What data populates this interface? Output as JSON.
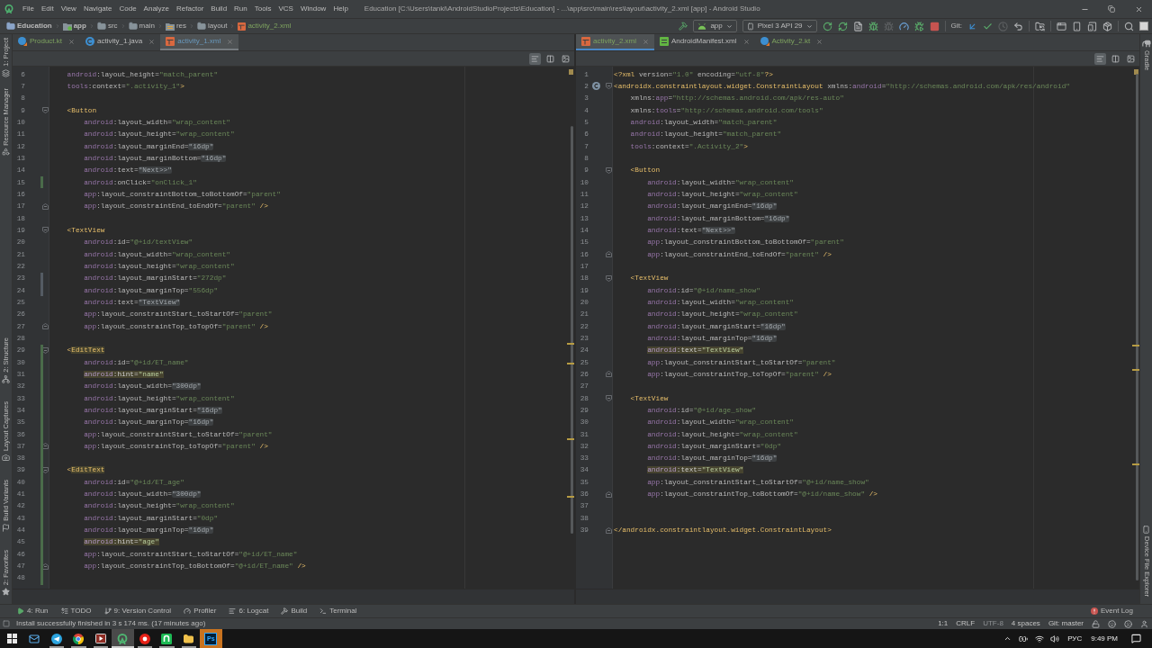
{
  "window": {
    "title": "Education [C:\\Users\\tanki\\AndroidStudioProjects\\Education] - ...\\app\\src\\main\\res\\layout\\activity_2.xml [app] - Android Studio"
  },
  "menu": [
    "File",
    "Edit",
    "View",
    "Navigate",
    "Code",
    "Analyze",
    "Refactor",
    "Build",
    "Run",
    "Tools",
    "VCS",
    "Window",
    "Help"
  ],
  "breadcrumbs": [
    {
      "label": "Education",
      "kind": "project"
    },
    {
      "label": "app",
      "kind": "module"
    },
    {
      "label": "src",
      "kind": "folder"
    },
    {
      "label": "main",
      "kind": "folder"
    },
    {
      "label": "res",
      "kind": "resources"
    },
    {
      "label": "layout",
      "kind": "folder"
    },
    {
      "label": "activity_2.xml",
      "kind": "layout-file"
    }
  ],
  "toolbar": {
    "run_config": "app",
    "device": "Pixel 3 API 29",
    "run_actions": [
      {
        "kind": "apply-changes",
        "disabled": false
      },
      {
        "kind": "apply-code",
        "disabled": false
      },
      {
        "kind": "run-document",
        "disabled": false
      },
      {
        "kind": "debug",
        "disabled": false
      },
      {
        "kind": "attach",
        "disabled": true
      },
      {
        "kind": "profile",
        "disabled": false
      },
      {
        "kind": "attach-debugger",
        "disabled": false
      },
      {
        "kind": "stop",
        "disabled": false
      }
    ],
    "vcs_label": "Git:",
    "vcs_actions": [
      {
        "kind": "update",
        "disabled": false
      },
      {
        "kind": "commit",
        "disabled": false
      },
      {
        "kind": "history",
        "disabled": true
      },
      {
        "kind": "rollback",
        "disabled": false
      }
    ]
  },
  "left_strip": {
    "top": [
      {
        "label": "1: Project",
        "kind": "project"
      },
      {
        "label": "Resource Manager",
        "kind": "resources"
      }
    ],
    "bottom": [
      {
        "label": "2: Structure",
        "kind": "structure"
      },
      {
        "label": "Layout Captures",
        "kind": "captures"
      },
      {
        "label": "Build Variants",
        "kind": "variants"
      },
      {
        "label": "2: Favorites",
        "kind": "favorites"
      }
    ]
  },
  "right_strip": {
    "top": [
      {
        "label": "Gradle",
        "kind": "gradle"
      }
    ],
    "bottom": [
      {
        "label": "Device File Explorer",
        "kind": "device"
      }
    ]
  },
  "editors": [
    {
      "focused": false,
      "tabs": [
        {
          "label": "Product.kt",
          "kind": "kotlin",
          "vcs": {
            "kind": "added"
          },
          "selected": false
        },
        {
          "label": "activity_1.java",
          "kind": "java",
          "vcs": {
            "kind": "unchanged"
          },
          "selected": false
        },
        {
          "label": "activity_1.xml",
          "kind": "layout",
          "vcs": {
            "kind": "modified"
          },
          "selected": true
        }
      ],
      "view_modes": [
        {
          "kind": "code",
          "selected": true
        },
        {
          "kind": "split",
          "selected": false
        },
        {
          "kind": "design",
          "selected": false
        }
      ],
      "lines": [
        {
          "n": "6",
          "kind": "plain",
          "code": "    android:layout_height=\"match_parent\""
        },
        {
          "n": "7",
          "kind": "plain",
          "code": "    tools:context=\".activity_1\">"
        },
        {
          "n": "8"
        },
        {
          "n": "9",
          "kind": "plain",
          "fold": {
            "kind": "start"
          },
          "code": "    <Button"
        },
        {
          "n": "10",
          "kind": "plain",
          "code": "        android:layout_width=\"wrap_content\""
        },
        {
          "n": "11",
          "kind": "plain",
          "code": "        android:layout_height=\"wrap_content\""
        },
        {
          "n": "12",
          "kind": "folded",
          "code": "        android:layout_marginEnd=\"16dp\""
        },
        {
          "n": "13",
          "kind": "folded",
          "code": "        android:layout_marginBottom=\"16dp\""
        },
        {
          "n": "14",
          "kind": "folded",
          "code": "        android:text=\"Next>>\""
        },
        {
          "n": "15",
          "kind": "plain",
          "change": {
            "kind": "added"
          },
          "code": "        android:onClick=\"onClick_1\""
        },
        {
          "n": "16",
          "kind": "plain",
          "code": "        app:layout_constraintBottom_toBottomOf=\"parent\""
        },
        {
          "n": "17",
          "kind": "plain",
          "fold": {
            "kind": "end"
          },
          "code": "        app:layout_constraintEnd_toEndOf=\"parent\" />"
        },
        {
          "n": "18"
        },
        {
          "n": "19",
          "kind": "plain",
          "fold": {
            "kind": "start"
          },
          "code": "    <TextView"
        },
        {
          "n": "20",
          "kind": "plain",
          "code": "        android:id=\"@+id/textView\""
        },
        {
          "n": "21",
          "kind": "plain",
          "code": "        android:layout_width=\"wrap_content\""
        },
        {
          "n": "22",
          "kind": "plain",
          "code": "        android:layout_height=\"wrap_content\""
        },
        {
          "n": "23",
          "kind": "plain",
          "change": {
            "kind": "modified"
          },
          "code": "        android:layout_marginStart=\"272dp\""
        },
        {
          "n": "24",
          "kind": "plain",
          "change": {
            "kind": "modified"
          },
          "code": "        android:layout_marginTop=\"556dp\""
        },
        {
          "n": "25",
          "kind": "folded",
          "code": "        android:text=\"TextView\""
        },
        {
          "n": "26",
          "kind": "plain",
          "code": "        app:layout_constraintStart_toStartOf=\"parent\""
        },
        {
          "n": "27",
          "kind": "plain",
          "fold": {
            "kind": "end"
          },
          "code": "        app:layout_constraintTop_toTopOf=\"parent\" />"
        },
        {
          "n": "28"
        },
        {
          "n": "29",
          "kind": "warntag",
          "fold": {
            "kind": "start"
          },
          "change": {
            "kind": "added"
          },
          "code": "    <EditText"
        },
        {
          "n": "30",
          "kind": "plain",
          "change": {
            "kind": "added"
          },
          "code": "        android:id=\"@+id/ET_name\""
        },
        {
          "n": "31",
          "kind": "warning",
          "change": {
            "kind": "added"
          },
          "code": "        android:hint=\"name\""
        },
        {
          "n": "32",
          "kind": "folded",
          "change": {
            "kind": "added"
          },
          "code": "        android:layout_width=\"300dp\""
        },
        {
          "n": "33",
          "kind": "plain",
          "change": {
            "kind": "added"
          },
          "code": "        android:layout_height=\"wrap_content\""
        },
        {
          "n": "34",
          "kind": "folded",
          "change": {
            "kind": "added"
          },
          "code": "        android:layout_marginStart=\"16dp\""
        },
        {
          "n": "35",
          "kind": "folded",
          "change": {
            "kind": "added"
          },
          "code": "        android:layout_marginTop=\"16dp\""
        },
        {
          "n": "36",
          "kind": "plain",
          "change": {
            "kind": "added"
          },
          "code": "        app:layout_constraintStart_toStartOf=\"parent\""
        },
        {
          "n": "37",
          "kind": "plain",
          "fold": {
            "kind": "end"
          },
          "change": {
            "kind": "added"
          },
          "code": "        app:layout_constraintTop_toTopOf=\"parent\" />"
        },
        {
          "n": "38",
          "change": {
            "kind": "added"
          }
        },
        {
          "n": "39",
          "kind": "warntag",
          "fold": {
            "kind": "start"
          },
          "change": {
            "kind": "added"
          },
          "code": "    <EditText"
        },
        {
          "n": "40",
          "kind": "plain",
          "change": {
            "kind": "added"
          },
          "code": "        android:id=\"@+id/ET_age\""
        },
        {
          "n": "41",
          "kind": "folded",
          "change": {
            "kind": "added"
          },
          "code": "        android:layout_width=\"300dp\""
        },
        {
          "n": "42",
          "kind": "plain",
          "change": {
            "kind": "added"
          },
          "code": "        android:layout_height=\"wrap_content\""
        },
        {
          "n": "43",
          "kind": "plain",
          "change": {
            "kind": "added"
          },
          "code": "        android:layout_marginStart=\"0dp\""
        },
        {
          "n": "44",
          "kind": "folded",
          "change": {
            "kind": "added"
          },
          "code": "        android:layout_marginTop=\"16dp\""
        },
        {
          "n": "45",
          "kind": "warning",
          "change": {
            "kind": "added"
          },
          "code": "        android:hint=\"age\""
        },
        {
          "n": "46",
          "kind": "plain",
          "change": {
            "kind": "added"
          },
          "code": "        app:layout_constraintStart_toStartOf=\"@+id/ET_name\""
        },
        {
          "n": "47",
          "kind": "plain",
          "fold": {
            "kind": "end"
          },
          "change": {
            "kind": "added"
          },
          "code": "        app:layout_constraintTop_toBottomOf=\"@+id/ET_name\" />"
        },
        {
          "n": "48",
          "change": {
            "kind": "added"
          }
        }
      ]
    },
    {
      "focused": true,
      "tabs": [
        {
          "label": "activity_2.xml",
          "kind": "layout",
          "vcs": {
            "kind": "added"
          },
          "selected": true
        },
        {
          "label": "AndroidManifest.xml",
          "kind": "manifest",
          "vcs": {
            "kind": "unchanged"
          },
          "selected": false
        },
        {
          "label": "Activity_2.kt",
          "kind": "kotlin",
          "vcs": {
            "kind": "added"
          },
          "selected": false
        }
      ],
      "view_modes": [
        {
          "kind": "code",
          "selected": true
        },
        {
          "kind": "split",
          "selected": false
        },
        {
          "kind": "design",
          "selected": false
        }
      ],
      "lines": [
        {
          "n": "1",
          "kind": "plain",
          "code": "<?xml version=\"1.0\" encoding=\"utf-8\"?>"
        },
        {
          "n": "2",
          "kind": "namespace",
          "fold": {
            "kind": "start"
          },
          "marker": {
            "kind": "layout"
          },
          "code": "<androidx.constraintlayout.widget.ConstraintLayout xmlns:android=\"http://schemas.android.com/apk/res/android\""
        },
        {
          "n": "3",
          "kind": "namespace",
          "code": "    xmlns:app=\"http://schemas.android.com/apk/res-auto\""
        },
        {
          "n": "4",
          "kind": "namespace",
          "code": "    xmlns:tools=\"http://schemas.android.com/tools\""
        },
        {
          "n": "5",
          "kind": "plain",
          "code": "    android:layout_width=\"match_parent\""
        },
        {
          "n": "6",
          "kind": "plain",
          "code": "    android:layout_height=\"match_parent\""
        },
        {
          "n": "7",
          "kind": "plain",
          "code": "    tools:context=\".Activity_2\">"
        },
        {
          "n": "8"
        },
        {
          "n": "9",
          "kind": "plain",
          "fold": {
            "kind": "start"
          },
          "code": "    <Button"
        },
        {
          "n": "10",
          "kind": "plain",
          "code": "        android:layout_width=\"wrap_content\""
        },
        {
          "n": "11",
          "kind": "plain",
          "code": "        android:layout_height=\"wrap_content\""
        },
        {
          "n": "12",
          "kind": "folded",
          "code": "        android:layout_marginEnd=\"16dp\""
        },
        {
          "n": "13",
          "kind": "folded",
          "code": "        android:layout_marginBottom=\"16dp\""
        },
        {
          "n": "14",
          "kind": "folded",
          "code": "        android:text=\"Next>>\""
        },
        {
          "n": "15",
          "kind": "plain",
          "code": "        app:layout_constraintBottom_toBottomOf=\"parent\""
        },
        {
          "n": "16",
          "kind": "plain",
          "fold": {
            "kind": "end"
          },
          "code": "        app:layout_constraintEnd_toEndOf=\"parent\" />"
        },
        {
          "n": "17"
        },
        {
          "n": "18",
          "kind": "plain",
          "fold": {
            "kind": "start"
          },
          "code": "    <TextView"
        },
        {
          "n": "19",
          "kind": "plain",
          "code": "        android:id=\"@+id/name_show\""
        },
        {
          "n": "20",
          "kind": "plain",
          "code": "        android:layout_width=\"wrap_content\""
        },
        {
          "n": "21",
          "kind": "plain",
          "code": "        android:layout_height=\"wrap_content\""
        },
        {
          "n": "22",
          "kind": "folded",
          "code": "        android:layout_marginStart=\"16dp\""
        },
        {
          "n": "23",
          "kind": "folded",
          "code": "        android:layout_marginTop=\"16dp\""
        },
        {
          "n": "24",
          "kind": "warning",
          "code": "        android:text=\"TextView\""
        },
        {
          "n": "25",
          "kind": "plain",
          "code": "        app:layout_constraintStart_toStartOf=\"parent\""
        },
        {
          "n": "26",
          "kind": "plain",
          "fold": {
            "kind": "end"
          },
          "code": "        app:layout_constraintTop_toTopOf=\"parent\" />"
        },
        {
          "n": "27"
        },
        {
          "n": "28",
          "kind": "plain",
          "fold": {
            "kind": "start"
          },
          "code": "    <TextView"
        },
        {
          "n": "29",
          "kind": "plain",
          "code": "        android:id=\"@+id/age_show\""
        },
        {
          "n": "30",
          "kind": "plain",
          "code": "        android:layout_width=\"wrap_content\""
        },
        {
          "n": "31",
          "kind": "plain",
          "code": "        android:layout_height=\"wrap_content\""
        },
        {
          "n": "32",
          "kind": "plain",
          "code": "        android:layout_marginStart=\"0dp\""
        },
        {
          "n": "33",
          "kind": "folded",
          "code": "        android:layout_marginTop=\"16dp\""
        },
        {
          "n": "34",
          "kind": "warning",
          "code": "        android:text=\"TextView\""
        },
        {
          "n": "35",
          "kind": "plain",
          "code": "        app:layout_constraintStart_toStartOf=\"@+id/name_show\""
        },
        {
          "n": "36",
          "kind": "plain",
          "fold": {
            "kind": "end"
          },
          "code": "        app:layout_constraintTop_toBottomOf=\"@+id/name_show\" />"
        },
        {
          "n": "37"
        },
        {
          "n": "38"
        },
        {
          "n": "39",
          "kind": "plain",
          "fold": {
            "kind": "end"
          },
          "code": "</androidx.constraintlayout.widget.ConstraintLayout>"
        }
      ]
    }
  ],
  "tool_windows": [
    {
      "label": "4: Run",
      "kind": "run"
    },
    {
      "label": "TODO",
      "kind": "todo"
    },
    {
      "label": "9: Version Control",
      "kind": "vcs"
    },
    {
      "label": "Profiler",
      "kind": "profiler"
    },
    {
      "label": "6: Logcat",
      "kind": "logcat"
    },
    {
      "label": "Build",
      "kind": "build"
    },
    {
      "label": "Terminal",
      "kind": "terminal"
    }
  ],
  "event_log": "Event Log",
  "status_bar": {
    "message": "Install successfully finished in 3 s 174 ms. (17 minutes ago)",
    "widgets": [
      {
        "label": "1:1",
        "disabled": false
      },
      {
        "label": "CRLF",
        "disabled": false
      },
      {
        "label": "UTF-8",
        "disabled": true
      },
      {
        "label": "4 spaces",
        "disabled": false
      },
      {
        "label": "Git: master",
        "disabled": false
      }
    ]
  },
  "taskbar": {
    "apps": [
      {
        "kind": "mail",
        "running": false,
        "active": false,
        "flashing": false
      },
      {
        "kind": "plane",
        "running": true,
        "active": false,
        "flashing": false
      },
      {
        "kind": "browser",
        "running": true,
        "active": false,
        "flashing": false
      },
      {
        "kind": "video",
        "running": true,
        "active": false,
        "flashing": false
      },
      {
        "kind": "studio",
        "running": true,
        "active": true,
        "flashing": false
      },
      {
        "kind": "record",
        "running": true,
        "active": false,
        "flashing": false
      },
      {
        "kind": "tile",
        "running": true,
        "active": false,
        "flashing": false
      },
      {
        "kind": "folder",
        "running": true,
        "active": false,
        "flashing": false
      },
      {
        "kind": "ps",
        "label": "Ps",
        "running": false,
        "active": false,
        "flashing": true
      }
    ],
    "language": "РУС",
    "time": "9:49 PM"
  }
}
